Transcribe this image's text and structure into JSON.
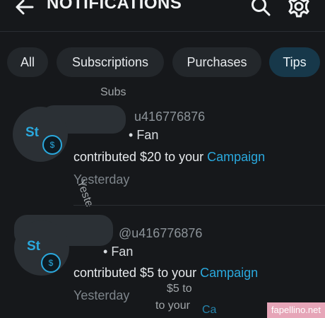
{
  "header": {
    "title": "NOTIFICATIONS",
    "back_icon": "arrow-left-icon",
    "search_icon": "search-icon",
    "settings_icon": "gear-icon"
  },
  "tabs": [
    {
      "label": "All",
      "active": false
    },
    {
      "label": "Subscriptions",
      "active": false
    },
    {
      "label": "Purchases",
      "active": false
    },
    {
      "label": "Tips",
      "active": true
    }
  ],
  "notifications": [
    {
      "initials": "St",
      "badge": "$",
      "handle": "u416776876",
      "role": "Fan",
      "message_prefix": "contributed $20 to your",
      "message_link": "Campaign",
      "time": "Yesterday"
    },
    {
      "initials": "St",
      "badge": "$",
      "handle": "@u416776876",
      "role": "Fan",
      "message_prefix": "contributed $5 to your",
      "message_link": "Campaign",
      "time": "Yesterday"
    }
  ],
  "artifacts": {
    "ghost_1": "Subs",
    "ghost_2": "Yeste",
    "ghost_3": "$5 to",
    "ghost_4": "to your",
    "ghost_5": "Ca"
  },
  "watermark": "fapellino.net",
  "colors": {
    "accent": "#2aa9de",
    "background": "#16181b",
    "tab_active": "#17384a",
    "tab": "#23272b"
  }
}
